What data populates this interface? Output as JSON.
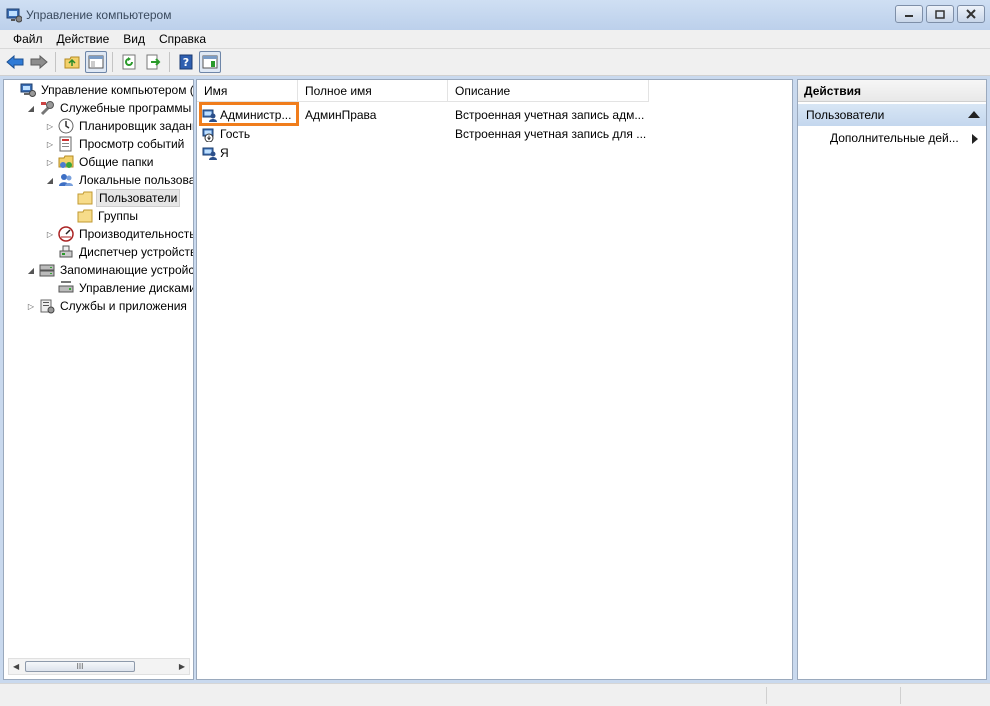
{
  "window": {
    "title": "Управление компьютером",
    "accent": "#f07d1c"
  },
  "menu": {
    "items": [
      "Файл",
      "Действие",
      "Вид",
      "Справка"
    ]
  },
  "toolbar": {
    "icons": [
      "back-arrow-icon",
      "forward-arrow-icon",
      "folder-up-icon",
      "show-hide-tree-icon",
      "refresh-icon",
      "export-list-icon",
      "help-icon",
      "show-hide-actions-icon"
    ]
  },
  "tree": {
    "items": [
      {
        "label": "Управление компьютером (л",
        "icon": "computer-management-icon",
        "level": 0,
        "expander": "none"
      },
      {
        "label": "Служебные программы",
        "icon": "system-tools-icon",
        "level": 1,
        "expander": "expanded"
      },
      {
        "label": "Планировщик заданий",
        "icon": "task-scheduler-icon",
        "level": 2,
        "expander": "collapsed"
      },
      {
        "label": "Просмотр событий",
        "icon": "event-viewer-icon",
        "level": 2,
        "expander": "collapsed"
      },
      {
        "label": "Общие папки",
        "icon": "shared-folders-icon",
        "level": 2,
        "expander": "collapsed"
      },
      {
        "label": "Локальные пользовате",
        "icon": "local-users-icon",
        "level": 2,
        "expander": "expanded"
      },
      {
        "label": "Пользователи",
        "icon": "folder-icon",
        "level": 3,
        "expander": "none",
        "selected": true
      },
      {
        "label": "Группы",
        "icon": "folder-icon",
        "level": 3,
        "expander": "none"
      },
      {
        "label": "Производительность",
        "icon": "performance-icon",
        "level": 2,
        "expander": "collapsed"
      },
      {
        "label": "Диспетчер устройств",
        "icon": "device-manager-icon",
        "level": 2,
        "expander": "none"
      },
      {
        "label": "Запоминающие устройст",
        "icon": "storage-icon",
        "level": 1,
        "expander": "expanded"
      },
      {
        "label": "Управление дисками",
        "icon": "disk-management-icon",
        "level": 2,
        "expander": "none"
      },
      {
        "label": "Службы и приложения",
        "icon": "services-apps-icon",
        "level": 1,
        "expander": "collapsed"
      }
    ],
    "scroll_glyph": "III"
  },
  "list": {
    "columns": [
      "Имя",
      "Полное имя",
      "Описание"
    ],
    "rows": [
      {
        "name": "Администр...",
        "full_name": "АдминПрава",
        "description": "Встроенная учетная запись адм...",
        "icon": "user-icon",
        "highlighted": true
      },
      {
        "name": "Гость",
        "full_name": "",
        "description": "Встроенная учетная запись для ...",
        "icon": "disabled-user-icon"
      },
      {
        "name": "Я",
        "full_name": "",
        "description": "",
        "icon": "user-icon"
      }
    ]
  },
  "actions": {
    "header": "Действия",
    "section": "Пользователи",
    "item": "Дополнительные дей..."
  }
}
